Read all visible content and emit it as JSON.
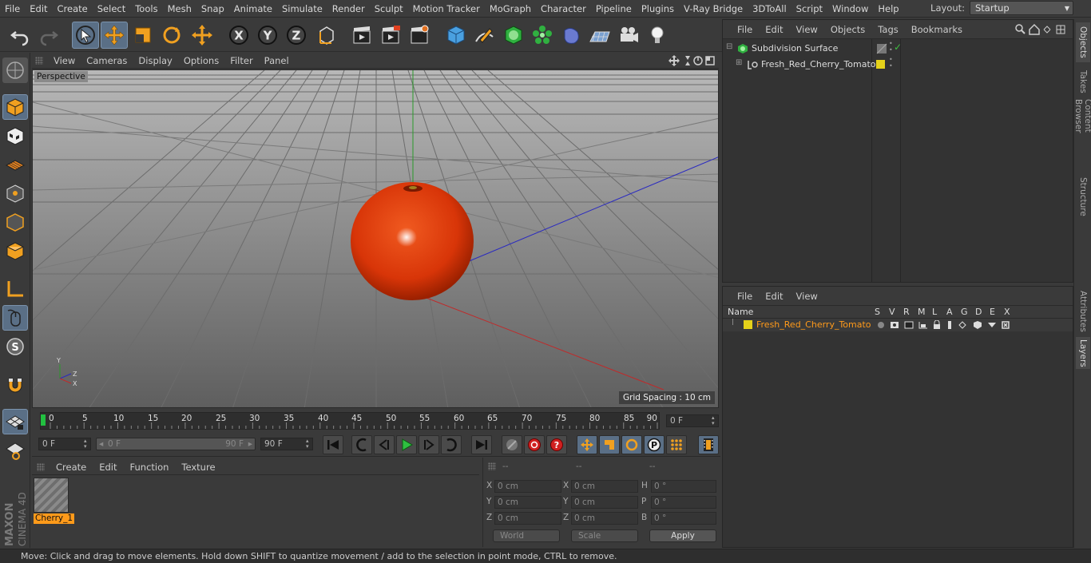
{
  "menubar": {
    "items": [
      "File",
      "Edit",
      "Create",
      "Select",
      "Tools",
      "Mesh",
      "Snap",
      "Animate",
      "Simulate",
      "Render",
      "Sculpt",
      "Motion Tracker",
      "MoGraph",
      "Character",
      "Pipeline",
      "Plugins",
      "V-Ray Bridge",
      "3DToAll",
      "Script",
      "Window",
      "Help"
    ],
    "layout_label": "Layout:",
    "layout_value": "Startup"
  },
  "viewport": {
    "menu": [
      "View",
      "Cameras",
      "Display",
      "Options",
      "Filter",
      "Panel"
    ],
    "label": "Perspective",
    "grid_spacing": "Grid Spacing : 10 cm",
    "axis_y": "Y",
    "axis_z": "Z",
    "axis_x": "X"
  },
  "timeline": {
    "ticks": [
      "0",
      "5",
      "10",
      "15",
      "20",
      "25",
      "30",
      "35",
      "40",
      "45",
      "50",
      "55",
      "60",
      "65",
      "70",
      "75",
      "80",
      "85",
      "90"
    ],
    "current_frame": "0 F"
  },
  "transport": {
    "start": "0 F",
    "range_start": "0 F",
    "range_end": "90 F",
    "end": "90 F"
  },
  "materials": {
    "menu": [
      "Create",
      "Edit",
      "Function",
      "Texture"
    ],
    "items": [
      {
        "label": "Cherry_1"
      }
    ]
  },
  "coords": {
    "headers": [
      "--",
      "--",
      "--"
    ],
    "rows": [
      {
        "a": "X",
        "av": "0 cm",
        "b": "X",
        "bv": "0 cm",
        "c": "H",
        "cv": "0 °"
      },
      {
        "a": "Y",
        "av": "0 cm",
        "b": "Y",
        "bv": "0 cm",
        "c": "P",
        "cv": "0 °"
      },
      {
        "a": "Z",
        "av": "0 cm",
        "b": "Z",
        "bv": "0 cm",
        "c": "B",
        "cv": "0 °"
      }
    ],
    "space": "World",
    "mode": "Scale",
    "apply": "Apply"
  },
  "objects": {
    "menu": [
      "File",
      "Edit",
      "View",
      "Objects",
      "Tags",
      "Bookmarks"
    ],
    "items": [
      {
        "name": "Subdivision Surface"
      },
      {
        "name": "Fresh_Red_Cherry_Tomato"
      }
    ]
  },
  "layers": {
    "menu": [
      "File",
      "Edit",
      "View"
    ],
    "name_header": "Name",
    "columns": [
      "S",
      "V",
      "R",
      "M",
      "L",
      "A",
      "G",
      "D",
      "E",
      "X"
    ],
    "items": [
      {
        "name": "Fresh_Red_Cherry_Tomato",
        "color": "#e5d21a"
      }
    ]
  },
  "right_tabs": [
    "Objects",
    "Takes",
    "Content Browser",
    "Structure",
    "Attributes",
    "Layers"
  ],
  "brand": {
    "maker": "MAXON",
    "product": "CINEMA 4D"
  },
  "status": "Move: Click and drag to move elements. Hold down SHIFT to quantize movement / add to the selection in point mode, CTRL to remove.",
  "colors": {
    "accent": "#5a6f86",
    "tomato": "#e03a10",
    "layer": "#e5d21a",
    "selection": "#ff9a1a"
  }
}
